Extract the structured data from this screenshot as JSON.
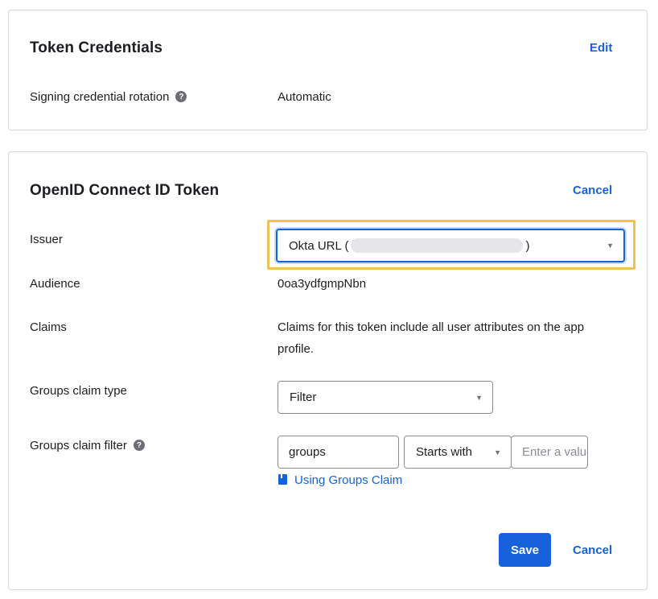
{
  "token_credentials": {
    "title": "Token Credentials",
    "edit_label": "Edit",
    "rotation_label": "Signing credential rotation",
    "rotation_value": "Automatic"
  },
  "oidc": {
    "title": "OpenID Connect ID Token",
    "cancel_top_label": "Cancel",
    "issuer_label": "Issuer",
    "issuer_prefix": "Okta URL (",
    "issuer_suffix": ")",
    "audience_label": "Audience",
    "audience_value": "0oa3ydfgmpNbn",
    "claims_label": "Claims",
    "claims_line1": "Claims for this token include all user attributes on the app",
    "claims_line2": "profile.",
    "groups_type_label": "Groups claim type",
    "groups_type_value": "Filter",
    "groups_filter_label": "Groups claim filter",
    "groups_filter_name": "groups",
    "groups_filter_operator": "Starts with",
    "groups_filter_value_placeholder": "Enter a value",
    "groups_claim_link": "Using Groups Claim",
    "save_label": "Save",
    "cancel_bottom_label": "Cancel"
  },
  "colors": {
    "accent": "#1662dd",
    "highlight": "#f0c24f"
  },
  "icons": [
    "help-icon",
    "chevron-down-icon",
    "book-icon"
  ]
}
